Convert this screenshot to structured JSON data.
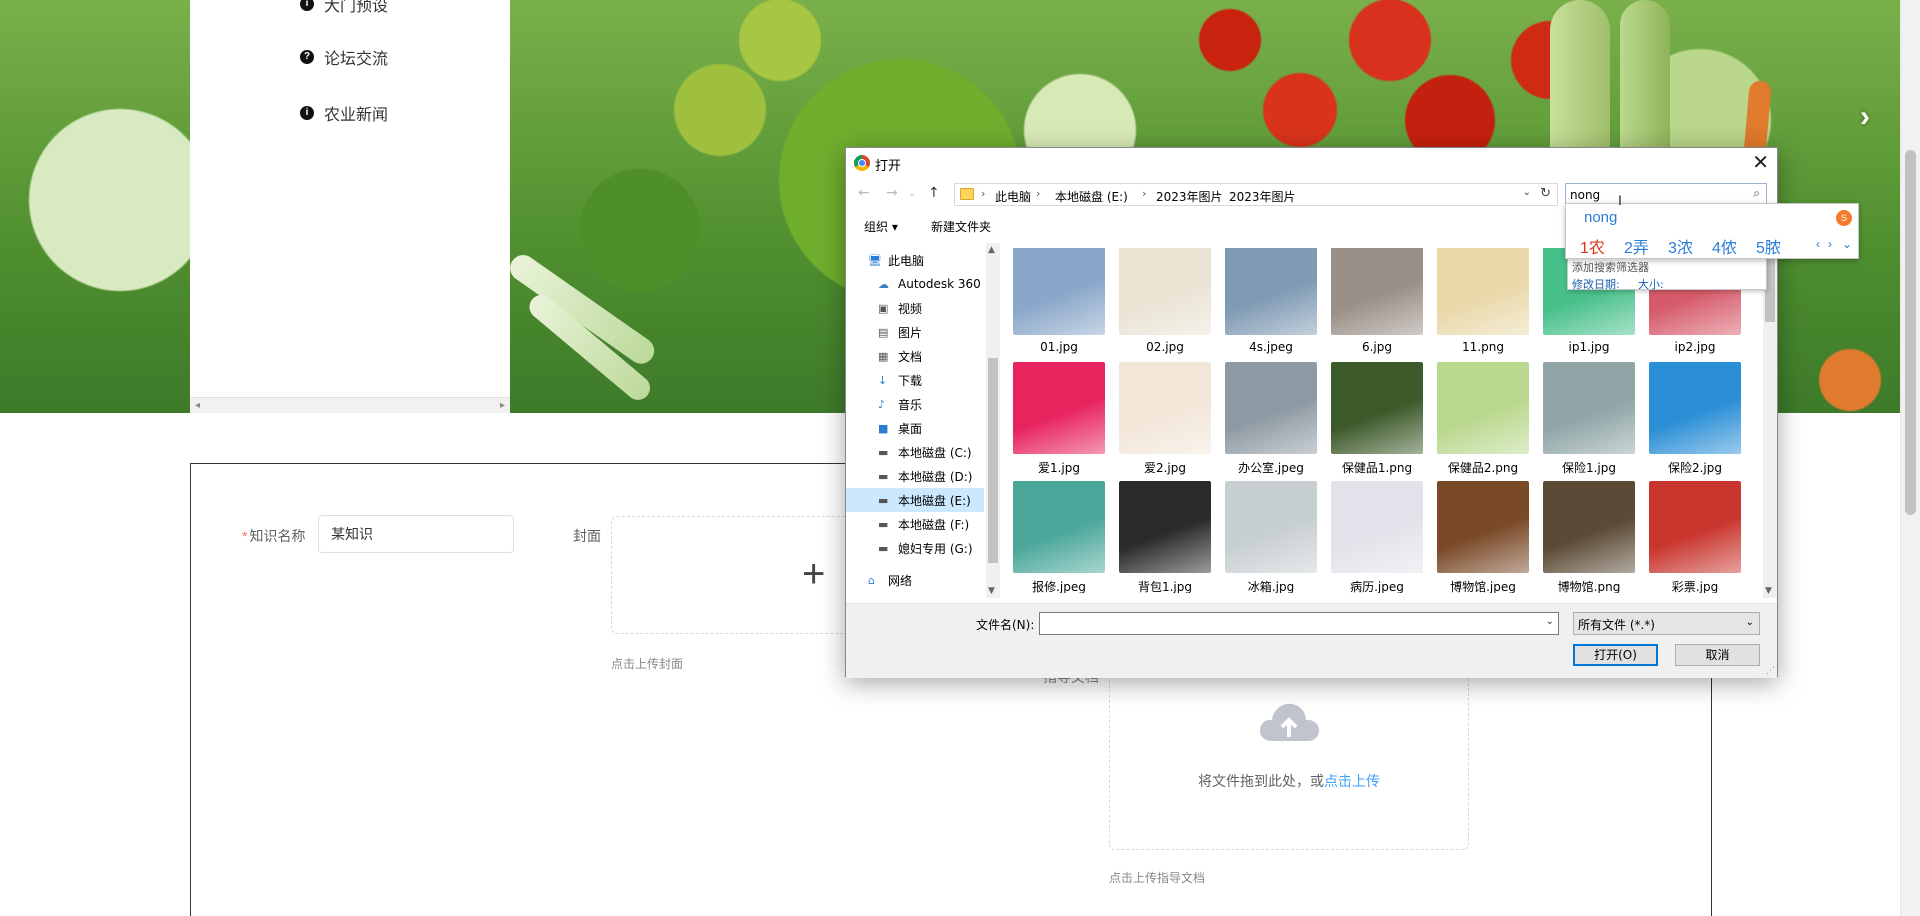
{
  "side_menu": {
    "items": [
      {
        "label": "大门预设",
        "icon": "info-icon"
      },
      {
        "label": "论坛交流",
        "icon": "question-icon"
      },
      {
        "label": "农业新闻",
        "icon": "info-icon"
      }
    ]
  },
  "form": {
    "name_label": "知识名称",
    "name_value": "某知识",
    "cover_label": "封面",
    "cover_tip": "点击上传封面",
    "doc_label": "指导文档",
    "doc_drop_text": "将文件拖到此处，或",
    "doc_drop_link": "点击上传",
    "doc_tip": "点击上传指导文档"
  },
  "dialog": {
    "title": "打开",
    "breadcrumb": [
      "此电脑",
      "本地磁盘 (E:)",
      "2023年图片",
      "2023年图片"
    ],
    "search_value": "nong",
    "toolbar": {
      "organize": "组织 ▾",
      "new_folder": "新建文件夹"
    },
    "nav_items": [
      {
        "label": "此电脑",
        "icon": "computer-icon",
        "indent": 0
      },
      {
        "label": "Autodesk 360",
        "icon": "cloud-icon",
        "indent": 1
      },
      {
        "label": "视频",
        "icon": "video-icon",
        "indent": 1
      },
      {
        "label": "图片",
        "icon": "pictures-icon",
        "indent": 1
      },
      {
        "label": "文档",
        "icon": "documents-icon",
        "indent": 1
      },
      {
        "label": "下载",
        "icon": "download-icon",
        "indent": 1
      },
      {
        "label": "音乐",
        "icon": "music-icon",
        "indent": 1
      },
      {
        "label": "桌面",
        "icon": "desktop-icon",
        "indent": 1
      },
      {
        "label": "本地磁盘 (C:)",
        "icon": "drive-icon",
        "indent": 1
      },
      {
        "label": "本地磁盘 (D:)",
        "icon": "drive-icon",
        "indent": 1
      },
      {
        "label": "本地磁盘 (E:)",
        "icon": "drive-icon",
        "indent": 1,
        "selected": true
      },
      {
        "label": "本地磁盘 (F:)",
        "icon": "drive-icon",
        "indent": 1
      },
      {
        "label": "媳妇专用 (G:)",
        "icon": "drive-icon",
        "indent": 1
      },
      {
        "label": "网络",
        "icon": "network-icon",
        "indent": 0
      }
    ],
    "files": [
      {
        "name": "01.jpg",
        "color": "#8aa7c9"
      },
      {
        "name": "02.jpg",
        "color": "#e9e3d3"
      },
      {
        "name": "4s.jpeg",
        "color": "#7f9ab3"
      },
      {
        "name": "6.jpg",
        "color": "#9a8f86"
      },
      {
        "name": "11.png",
        "color": "#e9d8a8"
      },
      {
        "name": "ip1.jpg",
        "color": "#47c08a"
      },
      {
        "name": "ip2.jpg",
        "color": "#d65a6a"
      },
      {
        "name": "爱1.jpg",
        "color": "#e8245f"
      },
      {
        "name": "爱2.jpg",
        "color": "#f2e6d8"
      },
      {
        "name": "办公室.jpeg",
        "color": "#8e9aa3"
      },
      {
        "name": "保健品1.png",
        "color": "#3d5a2a"
      },
      {
        "name": "保健品2.png",
        "color": "#b9d88d"
      },
      {
        "name": "保险1.jpg",
        "color": "#8fa5a6"
      },
      {
        "name": "保险2.jpg",
        "color": "#2b8fd6"
      },
      {
        "name": "报修.jpeg",
        "color": "#4aa79a"
      },
      {
        "name": "背包1.jpg",
        "color": "#2b2b2b"
      },
      {
        "name": "冰箱.jpg",
        "color": "#c8cfd2"
      },
      {
        "name": "病历.jpeg",
        "color": "#e2e2ea"
      },
      {
        "name": "博物馆.jpeg",
        "color": "#7a4a28"
      },
      {
        "name": "博物馆.png",
        "color": "#5b4a35"
      },
      {
        "name": "彩票.jpg",
        "color": "#c9362e"
      }
    ],
    "filename_label": "文件名(N):",
    "filename_value": "",
    "filetype": "所有文件 (*.*)",
    "open_button": "打开(O)",
    "cancel_button": "取消",
    "search_suggest": {
      "filter_label": "添加搜索筛选器",
      "modified_label": "修改日期:",
      "size_label": "大小:"
    }
  },
  "ime": {
    "pinyin": "nong",
    "candidates": [
      "1农",
      "2弄",
      "3浓",
      "4侬",
      "5脓"
    ]
  }
}
